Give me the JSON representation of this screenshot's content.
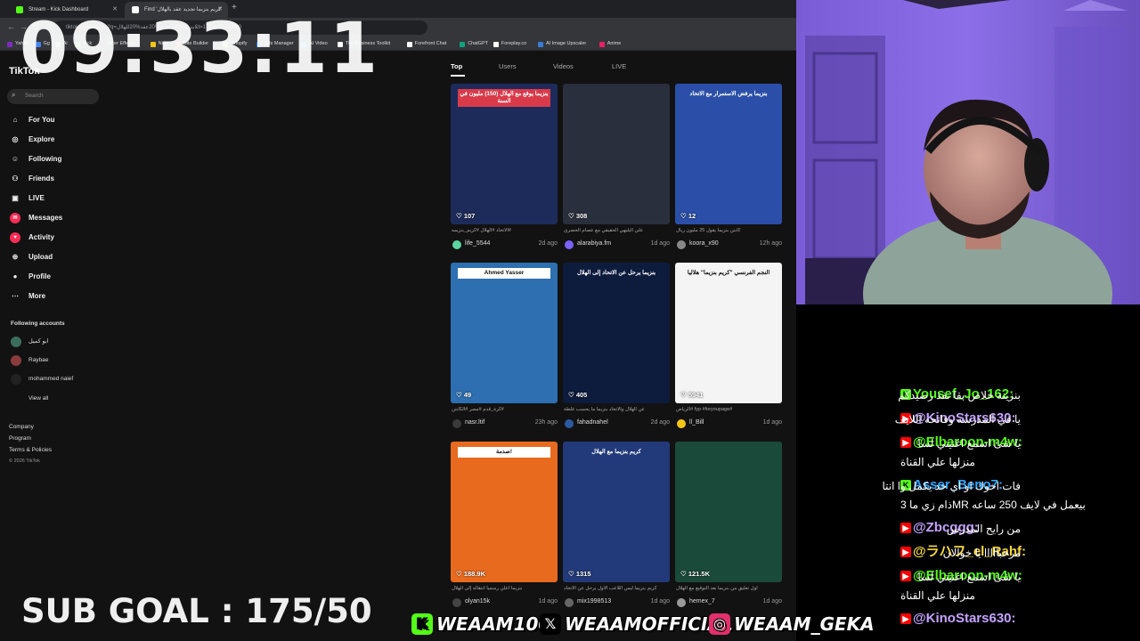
{
  "browser": {
    "tabs": [
      {
        "label": "Stream - Kick Dashboard",
        "color": "#53fc18"
      },
      {
        "label": "Find 'كريم بنزيما تجديد عقد بالهلال'",
        "color": "#ffffff"
      }
    ],
    "url": "tiktok.com/search?q=بنزيما%20تجديد%20عقد%20للهلال&t=1770187150060",
    "bookmarks": [
      {
        "label": "Yahoo",
        "color": "#7b2cbf"
      },
      {
        "label": "Gg",
        "color": "#4285f4"
      },
      {
        "label": "Ai",
        "color": "#888888"
      },
      {
        "label": "Kick",
        "color": "#53fc18"
      },
      {
        "label": "After Effects",
        "color": "#2a0a5e"
      },
      {
        "label": "Note",
        "color": "#f5c518"
      },
      {
        "label": "Site Builder",
        "color": "#e94e1b"
      },
      {
        "label": "Shopify",
        "color": "#95bf47"
      },
      {
        "label": "Ads Manager",
        "color": "#1877f2"
      },
      {
        "label": "AI Video",
        "color": "#0aa0ff"
      },
      {
        "label": "The Business Toolkit",
        "color": "#ffffff"
      },
      {
        "label": "Forefront Chat",
        "color": "#ffffff"
      },
      {
        "label": "ChatGPT",
        "color": "#10a37f"
      },
      {
        "label": "Foreplay.co",
        "color": "#ffffff"
      },
      {
        "label": "AI Image Upscaler",
        "color": "#3a7bd5"
      },
      {
        "label": "Anime",
        "color": "#e91e63"
      }
    ]
  },
  "sidebar": {
    "logo": "TikTok",
    "search_placeholder": "Search",
    "nav": [
      {
        "label": "For You",
        "icon": "home-icon"
      },
      {
        "label": "Explore",
        "icon": "compass-icon"
      },
      {
        "label": "Following",
        "icon": "following-icon"
      },
      {
        "label": "Friends",
        "icon": "friends-icon"
      },
      {
        "label": "LIVE",
        "icon": "live-icon"
      },
      {
        "label": "Messages",
        "icon": "messages-icon",
        "badge": "9"
      },
      {
        "label": "Activity",
        "icon": "activity-icon",
        "badge": "99+"
      },
      {
        "label": "Upload",
        "icon": "upload-icon"
      },
      {
        "label": "Profile",
        "icon": "profile-icon"
      },
      {
        "label": "More",
        "icon": "more-icon"
      }
    ],
    "following_title": "Following accounts",
    "following": [
      {
        "name": "ابو كميل",
        "color": "#3b6e5a"
      },
      {
        "name": "Raybae",
        "color": "#8a3b3b"
      },
      {
        "name": "mohammed naief",
        "color": "#222222"
      }
    ],
    "view_all": "View all",
    "footer": [
      "Company",
      "Program",
      "Terms & Policies"
    ],
    "copyright": "© 2026 TikTok"
  },
  "results": {
    "tabs": [
      "Top",
      "Users",
      "Videos",
      "LIVE"
    ],
    "cards": [
      {
        "likes": "107",
        "caption": "#الاتحاد #الهلال #كريم_بنزيمه",
        "user": "life_5544",
        "time": "2d ago",
        "bg": "#1d2b5a",
        "banner": "بنزيما يوقع مع الهلال (150) مليون في السنة",
        "banner_bg": "#d93a4a"
      },
      {
        "likes": "308",
        "caption": "علي البليهي الحقيقي مع عصام الحضري",
        "user": "alarabiya.fm",
        "time": "1d ago",
        "bg": "#2a2f3d",
        "banner": "",
        "banner_bg": ""
      },
      {
        "likes": "12",
        "caption": "كابتن بنزيما يقول 25 مليون ريال",
        "user": "koora_x90",
        "time": "12h ago",
        "bg": "#2b4fa8",
        "banner": "بنزيما يرفض الاستمرار مع الاتحاد",
        "banner_bg": ""
      },
      {
        "likes": "49",
        "caption": "#كرة_قدم #مصر #الكابتن",
        "user": "nasr.ltif",
        "time": "23h ago",
        "bg": "#2d6fb0",
        "banner": "Ahmed Yasser",
        "banner_bg": "#ffffff"
      },
      {
        "likes": "405",
        "caption": "عن الهلال والاتحاد بنزيما ما يحسب غلطة",
        "user": "fahadnahel",
        "time": "2d ago",
        "bg": "#0d1b3d",
        "banner": "بنزيما يرحل عن الاتحاد إلى الهلال",
        "banner_bg": ""
      },
      {
        "likes": "5941",
        "caption": "#fyp #foryoupage #الرياض",
        "user": "ll_Bill",
        "time": "1d ago",
        "bg": "#f4f4f4",
        "banner": "النجم الفرنسي \"كريم بنزيما\" هلاليا",
        "banner_bg": ""
      },
      {
        "likes": "188.9K",
        "caption": "بنزيما أعلن رسميا انتقاله إلى الهلال",
        "user": "olyan15k",
        "time": "1d ago",
        "bg": "#e86a1f",
        "banner": "صدمة!",
        "banner_bg": "#ffffff"
      },
      {
        "likes": "1315",
        "caption": "كريم بنزيما ليس اللاعب الأول يرحل عن الاتحاد",
        "user": "mix1998513",
        "time": "1d ago",
        "bg": "#233a7a",
        "banner": "كريم بنزيما مع الهلال",
        "banner_bg": ""
      },
      {
        "likes": "121.5K",
        "caption": "أول تعليق من بنزيما بعد التوقيع مع الهلال",
        "user": "hemex_7",
        "time": "1d ago",
        "bg": "#1a4a3a",
        "banner": "",
        "banner_bg": ""
      }
    ]
  },
  "overlay": {
    "timer": "09:33:11",
    "sub_goal": "SUB GOAL : 175/50",
    "socials": [
      {
        "handle": "WEAAM100",
        "icon": "kick-icon",
        "color": "#53fc18"
      },
      {
        "handle": "WEAAMOFFICIAL",
        "icon": "x-icon",
        "color": "#000000"
      },
      {
        "handle": "WEAAM_GEKA",
        "icon": "instagram-icon",
        "color": "#e1306c"
      }
    ]
  },
  "chat": [
    {
      "platform": "kick",
      "user": "Yousef_Jo_162:",
      "text": "بنزينة خلاص بقا نفذ رصيدكم",
      "text2": "",
      "color": "#53fc18"
    },
    {
      "platform": "youtube",
      "user": "@KinoStars630:",
      "text": "يا في المدرسه وفاتحه اللايف",
      "text2": "",
      "color": "#c5a3ff"
    },
    {
      "platform": "youtube",
      "user": "@Elbaroon-m4w:",
      "text": "يا شئ اسمع اغنيتي لسا",
      "text2": "منزلها علي القناة",
      "color": "#53fc18"
    },
    {
      "platform": "kick",
      "user": "Asser_Beno7:",
      "text": "فات اخوك او اي حد يكمل وا انتا",
      "text2": "بيعمل في لايف 250 ساعه MRذام زي ما 3",
      "color": "#2fa8ff"
    },
    {
      "platform": "youtube",
      "user": "@Zbcggg:",
      "text": "من رايح المدرس",
      "text2": "",
      "color": "#c5a3ff"
    },
    {
      "platform": "youtube",
      "user": "@ラハフ_el_Rahf:",
      "text": "مرحبااااا يا خوالان",
      "text2": "",
      "color": "#f5d742"
    },
    {
      "platform": "youtube",
      "user": "@Elbaroon-m4w:",
      "text": "يا شئ اسمع اغنيتي لسا",
      "text2": "منزلها علي القناة",
      "color": "#53fc18"
    },
    {
      "platform": "youtube",
      "user": "@KinoStars630:",
      "text": "",
      "text2": "",
      "color": "#c5a3ff"
    }
  ]
}
